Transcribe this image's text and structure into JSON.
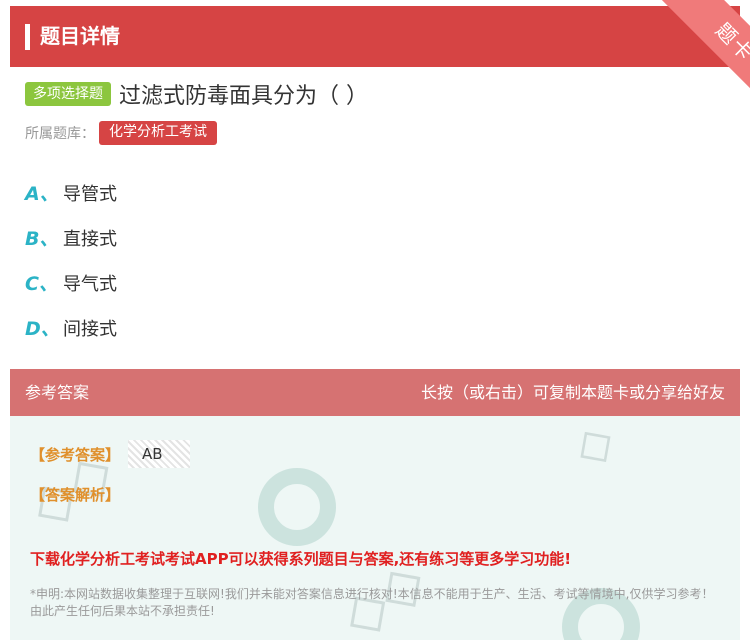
{
  "header": {
    "title": "题目详情",
    "ribbon": "题卡"
  },
  "question": {
    "type_badge": "多项选择题",
    "text": "过滤式防毒面具分为（ ）",
    "bank_label": "所属题库：",
    "bank_name": "化学分析工考试"
  },
  "options": [
    {
      "letter": "A、",
      "text": "导管式"
    },
    {
      "letter": "B、",
      "text": "直接式"
    },
    {
      "letter": "C、",
      "text": "导气式"
    },
    {
      "letter": "D、",
      "text": "间接式"
    }
  ],
  "answer": {
    "head_left": "参考答案",
    "head_right": "长按（或右击）可复制本题卡或分享给好友",
    "ref_label": "【参考答案】",
    "ref_value": "AB",
    "analysis_label": "【答案解析】",
    "promo": "下载化学分析工考试考试APP可以获得系列题目与答案,还有练习等更多学习功能!",
    "notice": "*申明:本网站数据收集整理于互联网!我们并未能对答案信息进行核对!本信息不能用于生产、生活、考试等情境中,仅供学习参考！由此产生任何后果本站不承担责任!"
  },
  "colors": {
    "header_red": "#d64444",
    "answer_head": "#d67272",
    "answer_bg": "#eef7f5",
    "option_letter": "#2bb3c6",
    "type_badge": "#8cc63e",
    "label_orange": "#e0902c",
    "promo_red": "#e02020"
  }
}
